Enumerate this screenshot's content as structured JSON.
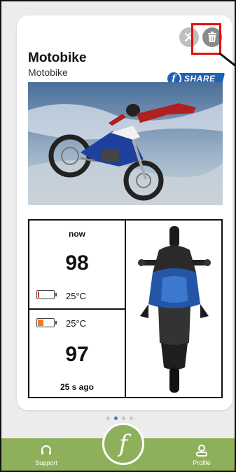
{
  "vehicle": {
    "title": "Motobike",
    "subtitle": "Motobike",
    "share_label": "SHARE",
    "share_logo_letter": "f"
  },
  "stats": {
    "top": {
      "time_label": "now",
      "value": "98",
      "temperature": "25°C",
      "battery_level": 0.1,
      "battery_color": "#e0402a"
    },
    "bottom": {
      "temperature": "25°C",
      "value": "97",
      "time_label": "25 s ago",
      "battery_level": 0.35,
      "battery_color": "#f07a24"
    }
  },
  "pagination": {
    "pages": 4,
    "active_index": 1
  },
  "bottom_nav": {
    "support_label": "Support",
    "profile_label": "Profile",
    "center_logo_letter": "f"
  },
  "colors": {
    "accent_green": "#8fb05a",
    "share_blue": "#1e62b5",
    "highlight_red": "#e01010"
  }
}
